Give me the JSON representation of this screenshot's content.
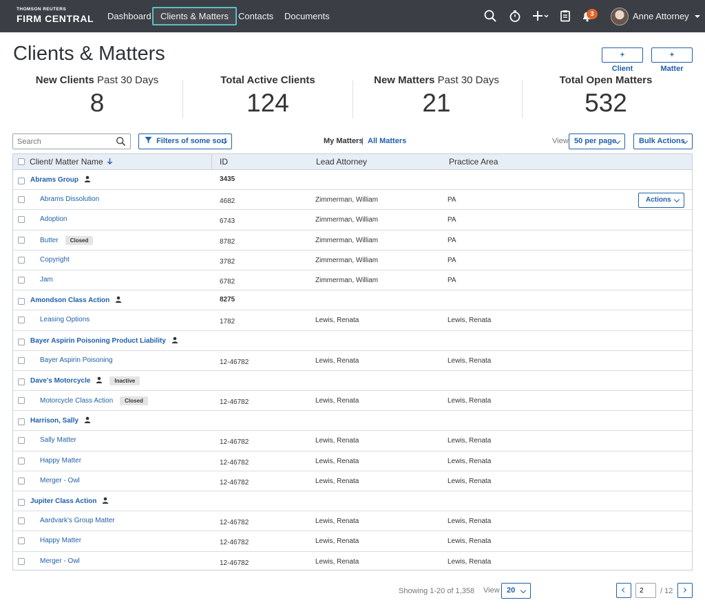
{
  "brand": {
    "sub": "THOMSON REUTERS",
    "main": "FIRM CENTRAL"
  },
  "nav": {
    "items": [
      {
        "label": "Dashboard"
      },
      {
        "label": "Clients & Matters",
        "active": true
      },
      {
        "label": "Contacts"
      },
      {
        "label": "Documents"
      }
    ],
    "icons": [
      "search-icon",
      "timer-icon",
      "plus-icon",
      "clipboard-icon",
      "bell-icon"
    ],
    "notification_count": "3",
    "user_name": "Anne Attorney"
  },
  "page": {
    "title": "Clients & Matters",
    "add_client_label": "+ Client",
    "add_matter_label": "+ Matter"
  },
  "stats": [
    {
      "label_bold": "New Clients",
      "label_rest": " Past 30 Days",
      "value": "8"
    },
    {
      "label_bold": "Total Active Clients",
      "label_rest": "",
      "value": "124"
    },
    {
      "label_bold": "New Matters",
      "label_rest": " Past 30 Days",
      "value": "21"
    },
    {
      "label_bold": "Total Open Matters",
      "label_rest": "",
      "value": "532"
    }
  ],
  "toolbar": {
    "search_placeholder": "Search",
    "filter_label": "Filters of some sort",
    "my_matters": "My Matters",
    "separator": "|",
    "all_matters": "All Matters",
    "view_label": "View",
    "per_page": "50 per page",
    "bulk_actions": "Bulk Actions"
  },
  "table": {
    "columns": [
      "Client/ Matter Name",
      "ID",
      "Lead Attorney",
      "Practice Area"
    ],
    "actions_label": "Actions",
    "rows": [
      {
        "type": "client",
        "name": "Abrams Group",
        "id": "3435",
        "attorney": "",
        "area": "",
        "tag": ""
      },
      {
        "type": "matter",
        "name": "Abrams Dissolution",
        "id": "4682",
        "attorney": "Zimmerman, William",
        "area": "PA",
        "tag": "",
        "actions": true
      },
      {
        "type": "matter",
        "name": "Adoption",
        "id": "6743",
        "attorney": "Zimmerman, William",
        "area": "PA",
        "tag": ""
      },
      {
        "type": "matter",
        "name": "Butter",
        "id": "8782",
        "attorney": "Zimmerman, William",
        "area": "PA",
        "tag": "Closed"
      },
      {
        "type": "matter",
        "name": "Copyright",
        "id": "3782",
        "attorney": "Zimmerman, William",
        "area": "PA",
        "tag": ""
      },
      {
        "type": "matter",
        "name": "Jam",
        "id": "6782",
        "attorney": "Zimmerman, William",
        "area": "PA",
        "tag": ""
      },
      {
        "type": "client",
        "name": "Amondson Class Action",
        "id": "8275",
        "attorney": "",
        "area": "",
        "tag": ""
      },
      {
        "type": "matter",
        "name": "Leasing Options",
        "id": "1782",
        "attorney": "Lewis, Renata",
        "area": "Lewis, Renata",
        "tag": ""
      },
      {
        "type": "client",
        "name": "Bayer Aspirin Poisoning Product Liability",
        "id": "",
        "attorney": "",
        "area": "",
        "tag": ""
      },
      {
        "type": "matter",
        "name": "Bayer Aspirin Poisoning",
        "id": "12-46782",
        "attorney": "Lewis, Renata",
        "area": "Lewis, Renata",
        "tag": ""
      },
      {
        "type": "client",
        "name": "Dave's Motorcycle",
        "id": "",
        "attorney": "",
        "area": "",
        "tag": "Inactive"
      },
      {
        "type": "matter",
        "name": "Motorcycle Class Action",
        "id": "12-46782",
        "attorney": "Lewis, Renata",
        "area": "Lewis, Renata",
        "tag": "Closed"
      },
      {
        "type": "client",
        "name": "Harrison, Sally",
        "id": "",
        "attorney": "",
        "area": "",
        "tag": ""
      },
      {
        "type": "matter",
        "name": "Sally Matter",
        "id": "12-46782",
        "attorney": "Lewis, Renata",
        "area": "Lewis, Renata",
        "tag": ""
      },
      {
        "type": "matter",
        "name": "Happy Matter",
        "id": "12-46782",
        "attorney": "Lewis, Renata",
        "area": "Lewis, Renata",
        "tag": ""
      },
      {
        "type": "matter",
        "name": "Merger - Owl",
        "id": "12-46782",
        "attorney": "Lewis, Renata",
        "area": "Lewis, Renata",
        "tag": ""
      },
      {
        "type": "client",
        "name": "Jupiter Class Action",
        "id": "",
        "attorney": "",
        "area": "",
        "tag": ""
      },
      {
        "type": "matter",
        "name": "Aardvark's Group Matter",
        "id": "12-46782",
        "attorney": "Lewis, Renata",
        "area": "Lewis, Renata",
        "tag": ""
      },
      {
        "type": "matter",
        "name": "Happy Matter",
        "id": "12-46782",
        "attorney": "Lewis, Renata",
        "area": "Lewis, Renata",
        "tag": ""
      },
      {
        "type": "matter",
        "name": "Merger - Owl",
        "id": "12-46782",
        "attorney": "Lewis, Renata",
        "area": "Lewis, Renata",
        "tag": ""
      }
    ]
  },
  "footer": {
    "showing": "Showing 1-20 of 1,358",
    "view_label": "View",
    "page_size": "20",
    "current_page": "2",
    "total_pages": "/ 12"
  },
  "colors": {
    "nav_bg": "#3b3e44",
    "accent": "#1f5fa8",
    "active_nav_border": "#5cc0c6",
    "badge": "#e0672b"
  }
}
